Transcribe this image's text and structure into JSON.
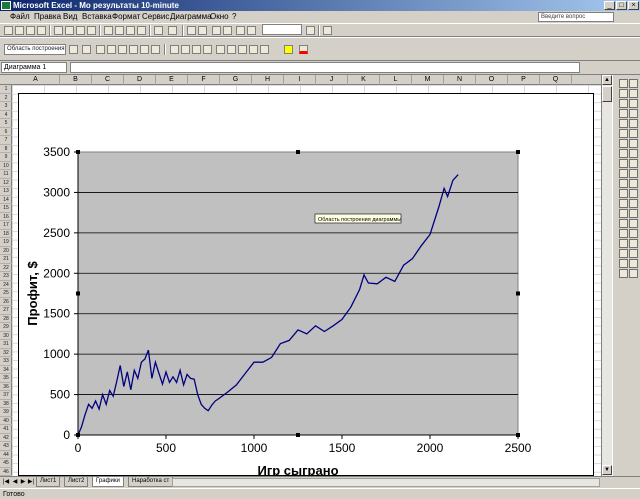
{
  "window": {
    "title": "Microsoft Excel - Мо результаты 10-minute",
    "minimize": "_",
    "maximize": "□",
    "close": "×"
  },
  "menu": [
    "Файл",
    "Правка",
    "Вид",
    "Вставка",
    "Формат",
    "Сервис",
    "Диаграмма",
    "Окно",
    "?"
  ],
  "help_box": "Введите вопрос",
  "toolbar2": {
    "chart_object_combo": "Область построения",
    "zoom_combo": ""
  },
  "formula_bar": {
    "name_box": "Диаграмма 1",
    "formula": ""
  },
  "columns": [
    "A",
    "B",
    "C",
    "D",
    "E",
    "F",
    "G",
    "H",
    "I",
    "J",
    "K",
    "L",
    "M",
    "N",
    "O",
    "P",
    "Q"
  ],
  "rows_first": 1,
  "rows_last": 46,
  "chart_tooltip": "Область построения диаграммы",
  "chart_data": {
    "type": "line",
    "title": "",
    "xlabel": "Игр сыграно",
    "ylabel": "Профит, $",
    "xlim": [
      0,
      2500
    ],
    "ylim": [
      0,
      3500
    ],
    "x_ticks": [
      "0",
      "500",
      "1000",
      "1500",
      "2000",
      "2500"
    ],
    "y_ticks": [
      "0",
      "500",
      "1000",
      "1500",
      "2000",
      "2500",
      "3000",
      "3500"
    ],
    "grid": "horizontal major",
    "plot_background": "#c0c0c0",
    "line_color": "#000080",
    "series": [
      {
        "x": [
          0,
          20,
          40,
          60,
          80,
          100,
          120,
          140,
          160,
          180,
          200,
          220,
          240,
          260,
          280,
          300,
          320,
          340,
          360,
          380,
          400,
          420,
          440,
          460,
          480,
          500,
          520,
          540,
          560,
          580,
          600,
          620,
          640,
          660,
          680,
          700,
          720,
          740,
          760,
          780,
          800,
          850,
          900,
          950,
          1000,
          1050,
          1100,
          1150,
          1200,
          1250,
          1300,
          1350,
          1400,
          1450,
          1500,
          1550,
          1600,
          1625,
          1650,
          1700,
          1750,
          1800,
          1850,
          1900,
          1950,
          2000,
          2050,
          2080,
          2100,
          2130,
          2160
        ],
        "y": [
          0,
          100,
          250,
          380,
          330,
          420,
          320,
          500,
          380,
          550,
          480,
          660,
          860,
          600,
          780,
          560,
          800,
          700,
          900,
          940,
          1050,
          700,
          900,
          760,
          630,
          780,
          650,
          720,
          650,
          800,
          620,
          750,
          700,
          690,
          500,
          380,
          330,
          300,
          370,
          420,
          450,
          530,
          620,
          760,
          900,
          900,
          960,
          1130,
          1170,
          1300,
          1250,
          1350,
          1280,
          1350,
          1430,
          1580,
          1800,
          1980,
          1880,
          1870,
          1950,
          1900,
          2100,
          2180,
          2340,
          2480,
          2820,
          3050,
          2950,
          3150,
          3220
        ]
      }
    ]
  },
  "sheet_tabs": [
    "Лист1",
    "Лист2",
    "Графики",
    "Наработка ст"
  ],
  "active_tab": 2,
  "status": "Готово"
}
